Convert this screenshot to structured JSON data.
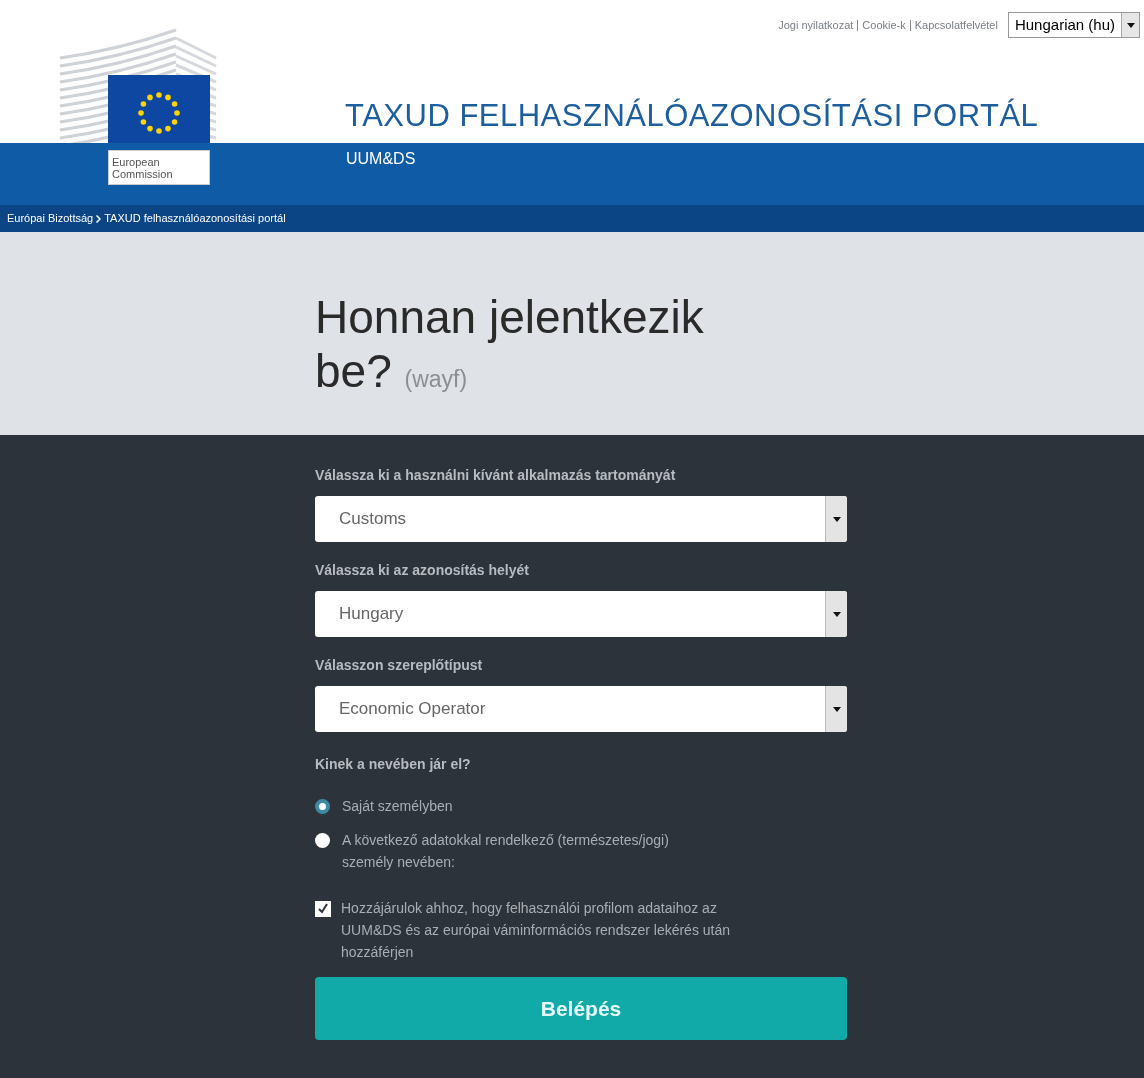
{
  "header": {
    "links": [
      "Jogi nyilatkozat",
      "Cookie-k",
      "Kapcsolatfelvétel"
    ],
    "language_select": {
      "value": "Hungarian (hu)"
    },
    "logo_text": [
      "European",
      "Commission"
    ],
    "title": "TAXUD FELHASZNÁLÓAZONOSÍTÁSI PORTÁL",
    "subtitle": "UUM&DS",
    "breadcrumb": [
      "Európai Bizottság",
      "TAXUD felhasználóazonosítási portál"
    ]
  },
  "hero": {
    "title": "Honnan jelentkezik be?",
    "suffix": "(wayf)"
  },
  "form": {
    "selects": [
      {
        "label": "Válassza ki a használni kívánt alkalmazás tartományát",
        "value": "Customs"
      },
      {
        "label": "Válassza ki az azonosítás helyét",
        "value": "Hungary"
      },
      {
        "label": "Válasszon szereplőtípust",
        "value": "Economic Operator"
      }
    ],
    "question": "Kinek a nevében jár el?",
    "radios": [
      {
        "label": "Saját személyben",
        "selected": true
      },
      {
        "label": "A következő adatokkal rendelkező (természetes/jogi) személy nevében:",
        "selected": false
      }
    ],
    "consent": {
      "label": "Hozzájárulok ahhoz, hogy felhasználói profilom adataihoz az UUM&DS és az európai váminformációs rendszer lekérés után hozzáférjen",
      "checked": true
    },
    "submit": "Belépés"
  }
}
